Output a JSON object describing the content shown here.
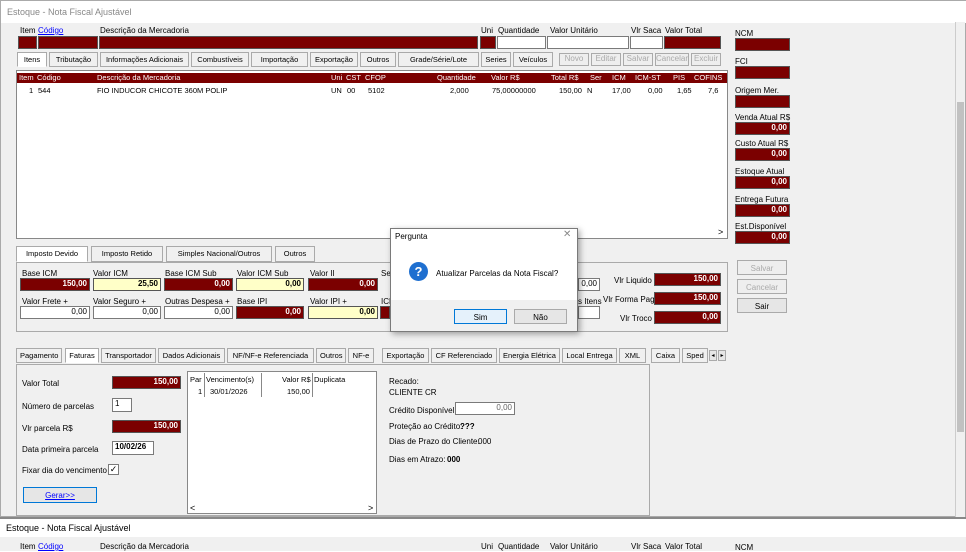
{
  "window": {
    "title": "Estoque - Nota Fiscal Ajustável"
  },
  "header": {
    "item": "Item",
    "codigo": "Código",
    "descricao": "Descrição da Mercadoria",
    "uni": "Uni",
    "quantidade": "Quantidade",
    "valor_unitario": "Valor Unitário",
    "vlr_saca": "Vlr Saca",
    "valor_total": "Valor Total"
  },
  "top_tabs": [
    "Itens",
    "Tributação",
    "Informações Adicionais",
    "Combustíveis",
    "Importação",
    "Exportação",
    "Outros",
    "Grade/Série/Lote",
    "Series",
    "Veículos"
  ],
  "item_buttons": [
    "Novo",
    "Editar",
    "Salvar",
    "Cancelar",
    "Excluir"
  ],
  "items_grid": {
    "headers": [
      "Item",
      "Código",
      "Descrição da Mercadoria",
      "Uni",
      "CST",
      "CFOP",
      "Quantidade",
      "Valor R$",
      "Total R$",
      "Ser",
      "ICM",
      "ICM-ST",
      "PIS",
      "COFINS"
    ],
    "rows": [
      [
        "1",
        "544",
        "FIO INDUCOR CHICOTE 360M POLIP",
        "UN",
        "00",
        "5102",
        "2,000",
        "75,00000000",
        "150,00",
        "N",
        "17,00",
        "0,00",
        "1,65",
        "7,6"
      ]
    ]
  },
  "right_panel": {
    "ncm": "NCM",
    "fci": "FCI",
    "origem": "Origem Mer.",
    "venda_label": "Venda Atual R$",
    "venda": "0,00",
    "custo_label": "Custo Atual R$",
    "custo": "0,00",
    "estoque_label": "Estoque Atual",
    "estoque": "0,00",
    "entrega_label": "Entrega Futura",
    "entrega": "0,00",
    "disp_label": "Est.Disponível",
    "disp": "0,00",
    "salvar": "Salvar",
    "cancelar": "Cancelar",
    "sair": "Sair"
  },
  "tax_tabs": [
    "Imposto Devido",
    "Imposto Retido",
    "Simples Nacional/Outros",
    "Outros"
  ],
  "tax": {
    "base_icm_l": "Base ICM",
    "base_icm": "150,00",
    "valor_icm_l": "Valor ICM",
    "valor_icm": "25,50",
    "base_icm_sub_l": "Base ICM Sub",
    "base_icm_sub": "0,00",
    "valor_icm_sub_l": "Valor ICM Sub",
    "valor_icm_sub": "0,00",
    "valor_ii_l": "Valor II",
    "valor_ii": "0,00",
    "se_l": "Se",
    "frete_l": "Valor Frete +",
    "frete": "0,00",
    "seguro_l": "Valor Seguro +",
    "seguro": "0,00",
    "outras_l": "Outras Despesa +",
    "outras": "0,00",
    "base_ipi_l": "Base IPI",
    "base_ipi": "0,00",
    "valor_ipi_l": "Valor IPI +",
    "valor_ipi": "0,00",
    "icm_l": "ICM",
    "small_val": "0,00",
    "itens_l": "s Itens",
    "vlr_liquido_l": "Vlr Liquido",
    "vlr_liquido": "150,00",
    "vlr_forma_l": "Vlr Forma Pag",
    "vlr_forma": "150,00",
    "vlr_troco_l": "Vlr Troco",
    "vlr_troco": "0,00"
  },
  "bottom_tabs": [
    "Pagamento",
    "Faturas",
    "Transportador",
    "Dados Adicionais",
    "NF/NF-e Referenciada",
    "Outros",
    "NF-e",
    "Exportação",
    "CF Referenciado",
    "Energia Elétrica",
    "Local Entrega",
    "XML",
    "Caixa",
    "Sped"
  ],
  "faturas": {
    "valor_total_l": "Valor Total",
    "valor_total": "150,00",
    "num_parcelas_l": "Número de parcelas",
    "num_parcelas": "1",
    "vlr_parcela_l": "Vlr parcela R$",
    "vlr_parcela": "150,00",
    "data_primeira_l": "Data primeira parcela",
    "data_primeira": "10/02/26",
    "fixar_l": "Fixar dia do vencimento",
    "gerar": "Gerar>>",
    "grid_headers": [
      "Par",
      "Vencimento(s)",
      "Valor R$",
      "Duplicata"
    ],
    "grid_rows": [
      [
        "1",
        "30/01/2026",
        "150,00",
        ""
      ]
    ],
    "recado_l": "Recado:",
    "cliente": "CLIENTE CR",
    "credito_l": "Crédito Disponível:",
    "credito": "0,00",
    "protecao_l": "Proteção ao Crédito:",
    "protecao": "???",
    "prazo_l": "Dias de Prazo do Cliente:",
    "prazo": "000",
    "atraso_l": "Dias em Atrazo:",
    "atraso": "000"
  },
  "dialog": {
    "title": "Pergunta",
    "message": "Atualizar Parcelas da Nota Fiscal?",
    "yes": "Sim",
    "no": "Não",
    "icon": "?"
  },
  "window2": {
    "title": "Estoque - Nota Fiscal Ajustável",
    "item": "Item",
    "codigo": "Código",
    "descricao": "Descrição da Mercadoria",
    "uni": "Uni",
    "quantidade": "Quantidade",
    "valor_unitario": "Valor Unitário",
    "vlr_saca": "Vlr Saca",
    "valor_total": "Valor Total",
    "ncm": "NCM"
  }
}
